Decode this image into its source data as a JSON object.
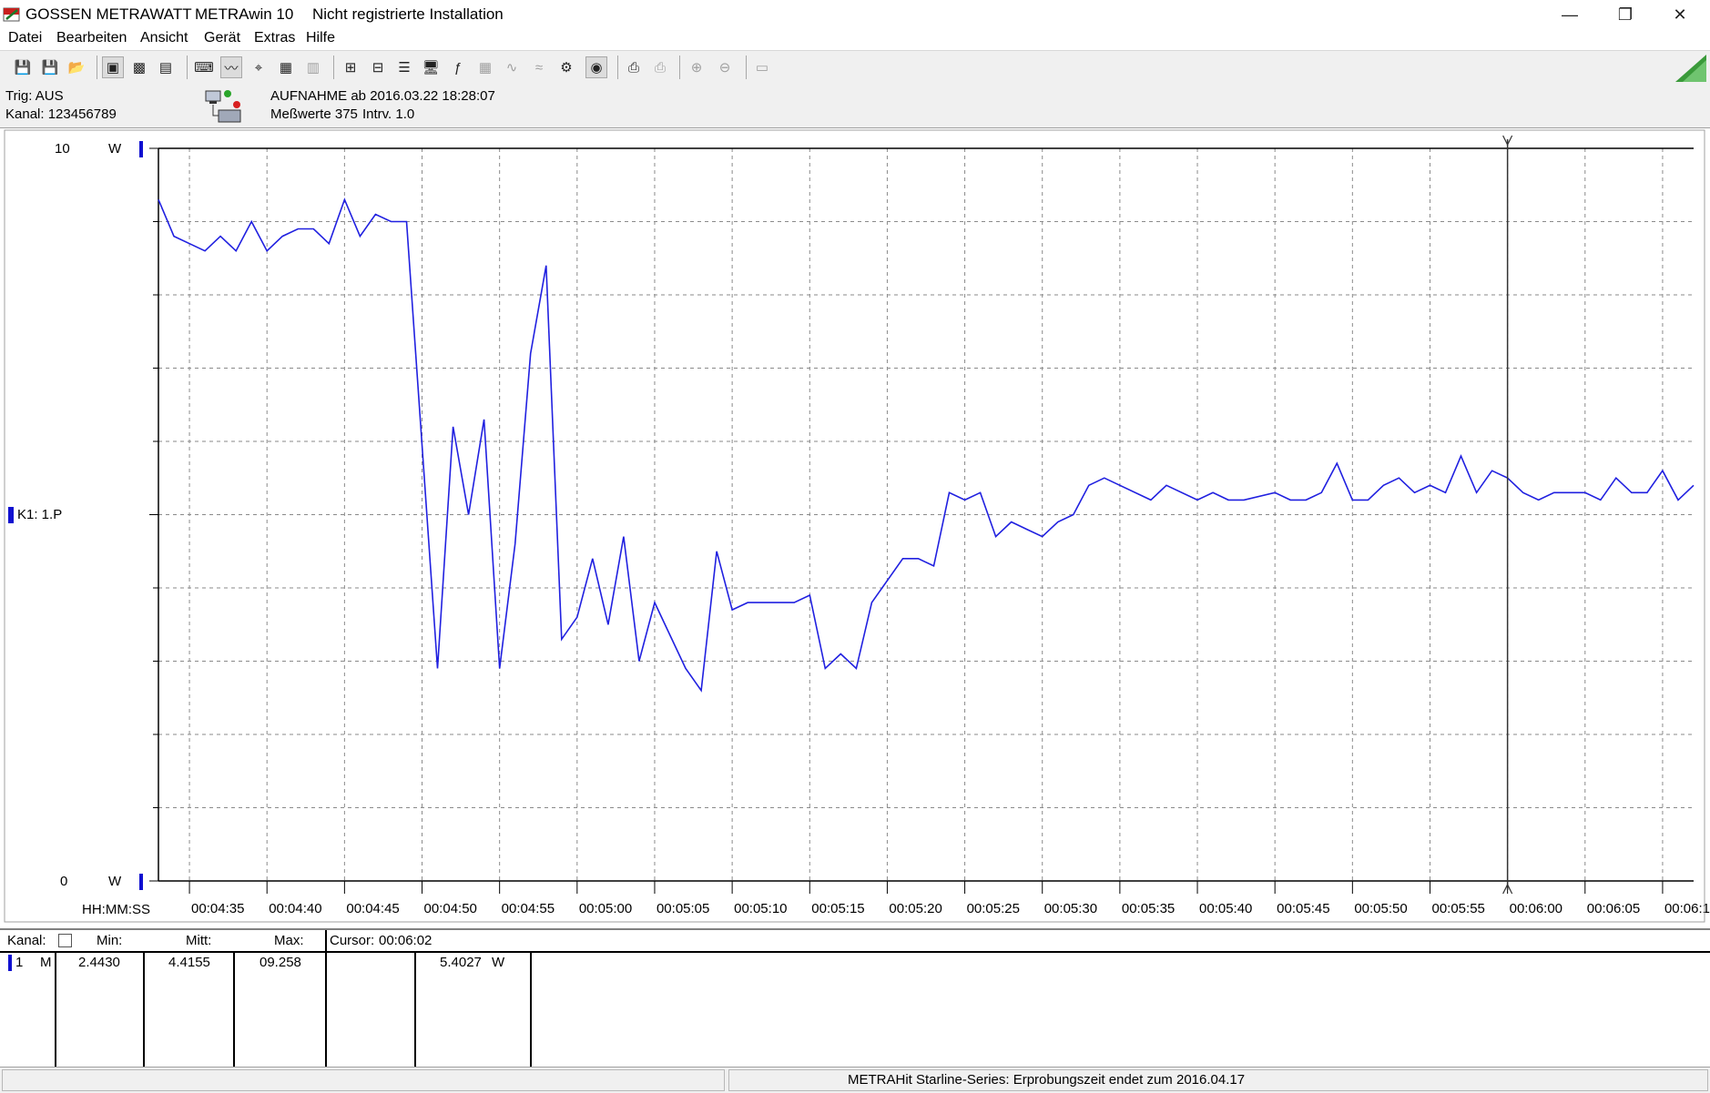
{
  "window": {
    "brand": "GOSSEN METRAWATT",
    "app": "METRAwin 10",
    "registration": "Nicht registrierte Installation",
    "controls": {
      "minimize": "—",
      "restore": "❐",
      "close": "✕"
    }
  },
  "menu": [
    "Datei",
    "Bearbeiten",
    "Ansicht",
    "Gerät",
    "Extras",
    "Hilfe"
  ],
  "toolbar_icons": [
    "save-icon",
    "save-as-icon",
    "open-icon",
    "device-read-icon",
    "device-stop-icon",
    "device-export-icon",
    "keyboard-icon",
    "waveform-icon",
    "crosshair-icon",
    "table-icon",
    "histogram-icon",
    "measure-icon",
    "data-icon",
    "list-icon",
    "monitor-icon",
    "function-icon",
    "grid-icon",
    "signal-icon",
    "trend-icon",
    "settings-icon",
    "gauge-icon",
    "print-icon",
    "print-preview-icon",
    "zoom-in-icon",
    "zoom-out-icon",
    "comment-icon"
  ],
  "info": {
    "trigger": "Trig: AUS",
    "channels": "Kanal: 123456789",
    "recording": "AUFNAHME ab 2016.03.22 18:28:07",
    "measurements": "Meßwerte 375",
    "interval": "Intrv. 1.0"
  },
  "chart_data": {
    "type": "line",
    "title": "",
    "xlabel": "HH:MM:SS",
    "ylabel": "W",
    "series_label": "K1: 1.P",
    "y_top_label": "10",
    "y_bottom_label": "0",
    "y_unit": "W",
    "ylim": [
      0,
      10
    ],
    "grid": true,
    "cursor_time": "00:06:00",
    "x_ticks": [
      "00:04:35",
      "00:04:40",
      "00:04:45",
      "00:04:50",
      "00:04:55",
      "00:05:00",
      "00:05:05",
      "00:05:10",
      "00:05:15",
      "00:05:20",
      "00:05:25",
      "00:05:30",
      "00:05:35",
      "00:05:40",
      "00:05:45",
      "00:05:50",
      "00:05:55",
      "00:06:00",
      "00:06:05",
      "00:06:10"
    ],
    "x_start": "00:04:33",
    "x_end": "00:06:12",
    "series": [
      {
        "color": "#2020e0",
        "points": [
          [
            "00:04:33",
            9.3
          ],
          [
            "00:04:34",
            8.8
          ],
          [
            "00:04:35",
            8.7
          ],
          [
            "00:04:36",
            8.6
          ],
          [
            "00:04:37",
            8.8
          ],
          [
            "00:04:38",
            8.6
          ],
          [
            "00:04:39",
            9.0
          ],
          [
            "00:04:40",
            8.6
          ],
          [
            "00:04:41",
            8.8
          ],
          [
            "00:04:42",
            8.9
          ],
          [
            "00:04:43",
            8.9
          ],
          [
            "00:04:44",
            8.7
          ],
          [
            "00:04:45",
            9.3
          ],
          [
            "00:04:46",
            8.8
          ],
          [
            "00:04:47",
            9.1
          ],
          [
            "00:04:48",
            9.0
          ],
          [
            "00:04:49",
            9.0
          ],
          [
            "00:04:51",
            2.9
          ],
          [
            "00:04:52",
            6.2
          ],
          [
            "00:04:53",
            5.0
          ],
          [
            "00:04:54",
            6.3
          ],
          [
            "00:04:55",
            2.9
          ],
          [
            "00:04:56",
            4.6
          ],
          [
            "00:04:57",
            7.2
          ],
          [
            "00:04:58",
            8.4
          ],
          [
            "00:04:59",
            3.3
          ],
          [
            "00:05:00",
            3.6
          ],
          [
            "00:05:01",
            4.4
          ],
          [
            "00:05:02",
            3.5
          ],
          [
            "00:05:03",
            4.7
          ],
          [
            "00:05:04",
            3.0
          ],
          [
            "00:05:05",
            3.8
          ],
          [
            "00:05:07",
            2.9
          ],
          [
            "00:05:08",
            2.6
          ],
          [
            "00:05:09",
            4.5
          ],
          [
            "00:05:10",
            3.7
          ],
          [
            "00:05:11",
            3.8
          ],
          [
            "00:05:12",
            3.8
          ],
          [
            "00:05:14",
            3.8
          ],
          [
            "00:05:15",
            3.9
          ],
          [
            "00:05:16",
            2.9
          ],
          [
            "00:05:17",
            3.1
          ],
          [
            "00:05:18",
            2.9
          ],
          [
            "00:05:19",
            3.8
          ],
          [
            "00:05:21",
            4.4
          ],
          [
            "00:05:22",
            4.4
          ],
          [
            "00:05:23",
            4.3
          ],
          [
            "00:05:24",
            5.3
          ],
          [
            "00:05:25",
            5.2
          ],
          [
            "00:05:26",
            5.3
          ],
          [
            "00:05:27",
            4.7
          ],
          [
            "00:05:28",
            4.9
          ],
          [
            "00:05:29",
            4.8
          ],
          [
            "00:05:30",
            4.7
          ],
          [
            "00:05:31",
            4.9
          ],
          [
            "00:05:32",
            5.0
          ],
          [
            "00:05:33",
            5.4
          ],
          [
            "00:05:34",
            5.5
          ],
          [
            "00:05:35",
            5.4
          ],
          [
            "00:05:37",
            5.2
          ],
          [
            "00:05:38",
            5.4
          ],
          [
            "00:05:40",
            5.2
          ],
          [
            "00:05:41",
            5.3
          ],
          [
            "00:05:42",
            5.2
          ],
          [
            "00:05:43",
            5.2
          ],
          [
            "00:05:45",
            5.3
          ],
          [
            "00:05:46",
            5.2
          ],
          [
            "00:05:47",
            5.2
          ],
          [
            "00:05:48",
            5.3
          ],
          [
            "00:05:49",
            5.7
          ],
          [
            "00:05:50",
            5.2
          ],
          [
            "00:05:51",
            5.2
          ],
          [
            "00:05:52",
            5.4
          ],
          [
            "00:05:53",
            5.5
          ],
          [
            "00:05:54",
            5.3
          ],
          [
            "00:05:55",
            5.4
          ],
          [
            "00:05:56",
            5.3
          ],
          [
            "00:05:57",
            5.8
          ],
          [
            "00:05:58",
            5.3
          ],
          [
            "00:05:59",
            5.6
          ],
          [
            "00:06:00",
            5.5
          ],
          [
            "00:06:01",
            5.3
          ],
          [
            "00:06:02",
            5.2
          ],
          [
            "00:06:03",
            5.3
          ],
          [
            "00:06:04",
            5.3
          ],
          [
            "00:06:05",
            5.3
          ],
          [
            "00:06:06",
            5.2
          ],
          [
            "00:06:07",
            5.5
          ],
          [
            "00:06:08",
            5.3
          ],
          [
            "00:06:09",
            5.3
          ],
          [
            "00:06:10",
            5.6
          ],
          [
            "00:06:11",
            5.2
          ],
          [
            "00:06:12",
            5.4
          ]
        ]
      }
    ]
  },
  "stats": {
    "headers": {
      "channel": "Kanal:",
      "min": "Min:",
      "mean": "Mitt:",
      "max": "Max:",
      "cursor": "Cursor:",
      "cursor_time": "00:06:02"
    },
    "row": {
      "channel": "1",
      "mode": "M",
      "min": "2.4430",
      "mean": "4.4155",
      "max": "09.258",
      "cursor_value": "5.4027",
      "unit": "W"
    }
  },
  "status": {
    "message": "METRAHit Starline-Series: Erprobungszeit endet zum  2016.04.17"
  }
}
